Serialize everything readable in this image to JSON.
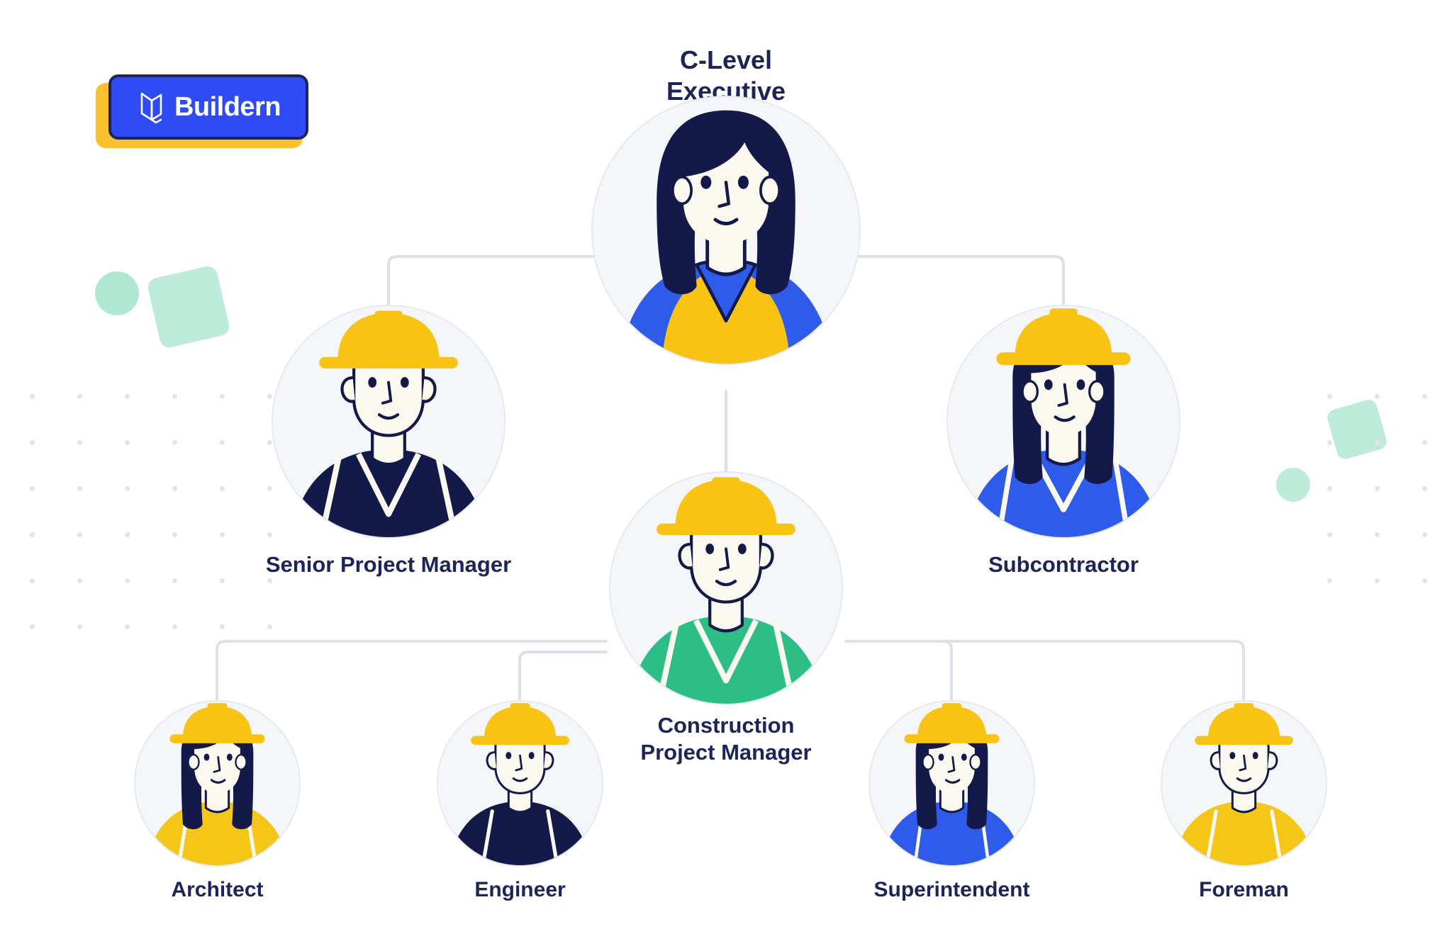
{
  "brand": {
    "name": "Buildern",
    "logo_icon": "buildern-cube-icon",
    "box_color": "#2F4BF5",
    "border_color": "#1B2559",
    "shadow_color": "#FBC02D",
    "text_color": "#FFFFFF"
  },
  "palette": {
    "label_text": "#1B2559",
    "avatar_bg": "#F4F6FA",
    "avatar_ring": "#E6E9F0",
    "connector": "#DCE0E8",
    "hardhat_yellow": "#F8C312",
    "shirt_blue": "#2F5BEA",
    "shirt_green": "#2DBE86",
    "shirt_navy": "#131a4a",
    "shirt_yellow": "#F5C518",
    "hair_navy": "#131a4a",
    "skin": "#FBF8F0",
    "deco_mint": "#BCEBDA",
    "deco_dot": "#E2E4EA"
  },
  "chart_data": {
    "type": "org-chart",
    "title": "C-Level Executive",
    "root": "exec",
    "nodes": [
      {
        "id": "exec",
        "label": "C-Level Executive",
        "level": 0,
        "parent": null,
        "avatar": "executive-woman-avatar",
        "hardhat": false,
        "hair": "long-dark",
        "shirt": "blue-with-yellow-vest"
      },
      {
        "id": "spm",
        "label": "Senior Project Manager",
        "level": 1,
        "parent": "exec",
        "avatar": "senior-project-manager-avatar",
        "hardhat": true,
        "hair": "short-dark",
        "shirt": "navy-v-neck"
      },
      {
        "id": "sub",
        "label": "Subcontractor",
        "level": 1,
        "parent": "exec",
        "avatar": "subcontractor-avatar",
        "hardhat": true,
        "hair": "long-dark",
        "shirt": "blue-v-neck"
      },
      {
        "id": "cpm",
        "label": "Construction\nProject Manager",
        "level": 1,
        "parent": "exec",
        "avatar": "construction-project-manager-avatar",
        "hardhat": true,
        "hair": "short-dark",
        "shirt": "green-v-neck"
      },
      {
        "id": "arch",
        "label": "Architect",
        "level": 2,
        "parent": "cpm",
        "avatar": "architect-avatar",
        "hardhat": true,
        "hair": "long-dark",
        "shirt": "yellow"
      },
      {
        "id": "eng",
        "label": "Engineer",
        "level": 2,
        "parent": "cpm",
        "avatar": "engineer-avatar",
        "hardhat": true,
        "hair": "short-dark",
        "shirt": "navy"
      },
      {
        "id": "super",
        "label": "Superintendent",
        "level": 2,
        "parent": "cpm",
        "avatar": "superintendent-avatar",
        "hardhat": true,
        "hair": "long-dark",
        "shirt": "blue"
      },
      {
        "id": "fore",
        "label": "Foreman",
        "level": 2,
        "parent": "cpm",
        "avatar": "foreman-avatar",
        "hardhat": true,
        "hair": "short-dark",
        "shirt": "yellow"
      }
    ],
    "edges": [
      {
        "from": "exec",
        "to": "spm"
      },
      {
        "from": "exec",
        "to": "sub"
      },
      {
        "from": "exec",
        "to": "cpm"
      },
      {
        "from": "cpm",
        "to": "arch"
      },
      {
        "from": "cpm",
        "to": "eng"
      },
      {
        "from": "cpm",
        "to": "super"
      },
      {
        "from": "cpm",
        "to": "fore"
      }
    ],
    "levels": 3,
    "legend": null,
    "notes": "Construction company organizational hierarchy chart"
  }
}
